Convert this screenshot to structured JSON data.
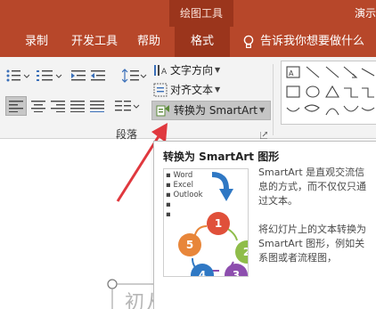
{
  "title_bar": {
    "context_group": "绘图工具",
    "title_fragment": "演示"
  },
  "tabs": [
    {
      "label": "录制"
    },
    {
      "label": "开发工具"
    },
    {
      "label": "帮助"
    },
    {
      "label": "格式"
    }
  ],
  "tell_me": {
    "label": "告诉我你想要做什么"
  },
  "ribbon": {
    "text_direction": "文字方向",
    "align_text": "对齐文本",
    "convert_smartart": "转换为 SmartArt",
    "paragraph_group": "段落"
  },
  "tooltip": {
    "title": "转换为 SmartArt 图形",
    "desc1": "SmartArt 是直观交流信息的方式，而不仅仅只通过文本。",
    "desc2": "将幻灯片上的文本转换为 SmartArt 图形，例如关系图或者流程图，",
    "preview_bullets": [
      "Word",
      "Excel",
      "Outlook"
    ],
    "preview_numbers": [
      "1",
      "2",
      "3",
      "4",
      "5"
    ]
  },
  "document": {
    "text_fragment": "初从"
  },
  "colors": {
    "ribbon_tab_bg": "#b7472a",
    "ribbon_tab_active": "#9b351c",
    "arrow_red": "#e0383e",
    "circle_1": "#e0503a",
    "circle_2": "#8fbd4a",
    "circle_3": "#8d4eae",
    "circle_4": "#2f78c4",
    "circle_5": "#e8863a"
  }
}
